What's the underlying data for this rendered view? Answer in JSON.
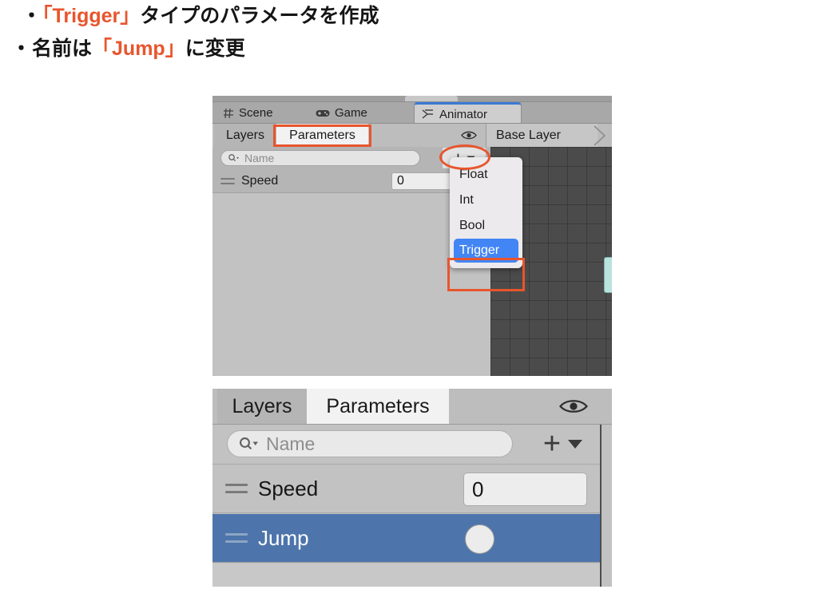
{
  "headings": {
    "line1": {
      "bullet": "・",
      "pre": "",
      "accent": "「Trigger」",
      "post": "タイプのパラメータを作成"
    },
    "line2": {
      "bullet": "・",
      "pre": "名前は",
      "accent": "「Jump」",
      "post": "に変更"
    }
  },
  "top_panel": {
    "tabs": [
      {
        "label": "Scene",
        "icon": "grid-icon",
        "active": false
      },
      {
        "label": "Game",
        "icon": "gamepad-icon",
        "active": false
      },
      {
        "label": "Animator",
        "icon": "animator-icon",
        "active": true
      }
    ],
    "subtabs": {
      "layers": "Layers",
      "parameters": "Parameters"
    },
    "eye_icon": "eye-icon",
    "breadcrumb": "Base Layer",
    "search": {
      "placeholder": "Name",
      "value": "",
      "icon": "search-icon"
    },
    "add_button": {
      "plus": "+",
      "caret": "▼"
    },
    "parameters": [
      {
        "name": "Speed",
        "type": "float",
        "value": "0"
      }
    ],
    "dropdown": {
      "items": [
        "Float",
        "Int",
        "Bool",
        "Trigger"
      ],
      "selected": "Trigger"
    }
  },
  "bottom_panel": {
    "subtabs": {
      "layers": "Layers",
      "parameters": "Parameters"
    },
    "eye_icon": "eye-icon",
    "search": {
      "placeholder": "Name",
      "value": "",
      "icon": "search-icon"
    },
    "add_button": {
      "plus": "+",
      "caret": "▼"
    },
    "parameters": [
      {
        "name": "Speed",
        "type": "float",
        "value": "0",
        "selected": false
      },
      {
        "name": "Jump",
        "type": "trigger",
        "value": "",
        "selected": true
      }
    ]
  },
  "colors": {
    "annotation": "#e8552d",
    "selection_blue": "#4d75ab",
    "menu_highlight": "#4285f4",
    "tab_accent": "#3a7ad4"
  }
}
